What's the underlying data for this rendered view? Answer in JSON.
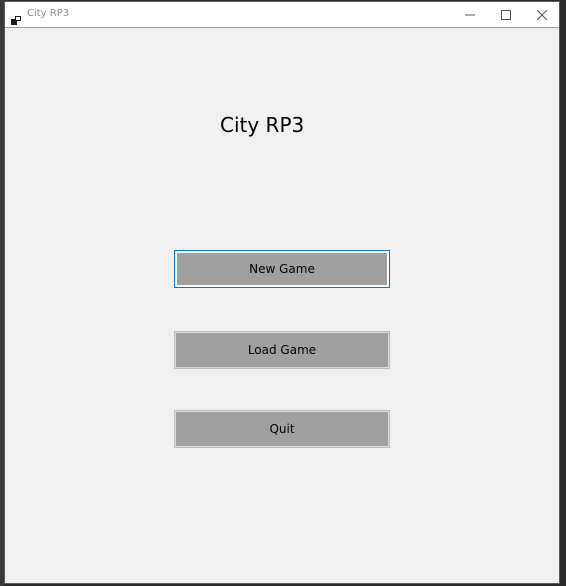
{
  "window": {
    "title": "City RP3",
    "icon": "app-window-icon",
    "controls": {
      "minimize_icon": "minimize-icon",
      "maximize_icon": "maximize-icon",
      "close_icon": "close-icon"
    }
  },
  "main": {
    "title": "City RP3",
    "buttons": {
      "new_game": "New Game",
      "load_game": "Load Game",
      "quit": "Quit"
    }
  },
  "colors": {
    "window_background": "#f0f0f0",
    "button_fill": "#a0a0a0",
    "focus_border": "#0078d7"
  }
}
